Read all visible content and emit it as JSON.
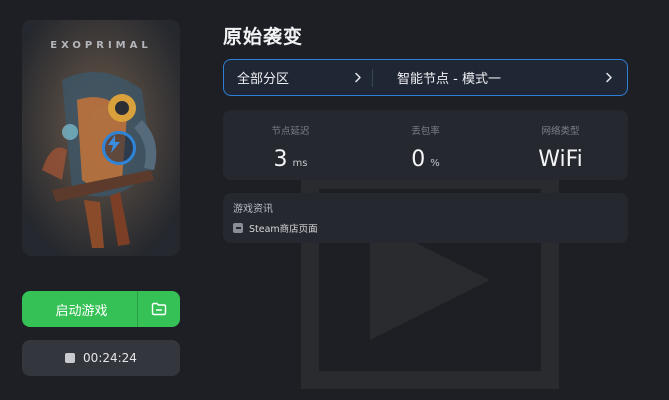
{
  "game": {
    "title": "原始袭变",
    "cover_art_text": "EXOPRIMAL"
  },
  "selector": {
    "region_label": "全部分区",
    "node_label": "智能节点 - 模式一"
  },
  "stats": {
    "latency": {
      "label": "节点延迟",
      "value": "3",
      "unit": "ms"
    },
    "packet_loss": {
      "label": "丢包率",
      "value": "0",
      "unit": "%"
    },
    "network_type": {
      "label": "网络类型",
      "value": "WiFi"
    }
  },
  "info": {
    "heading": "游戏资讯",
    "steam_link": "Steam商店页面"
  },
  "actions": {
    "launch_label": "启动游戏",
    "timer": "00:24:24"
  },
  "colors": {
    "accent_green": "#35c155",
    "accent_blue": "#2e7fd6",
    "background": "#1e1f24",
    "panel": "#262830"
  }
}
